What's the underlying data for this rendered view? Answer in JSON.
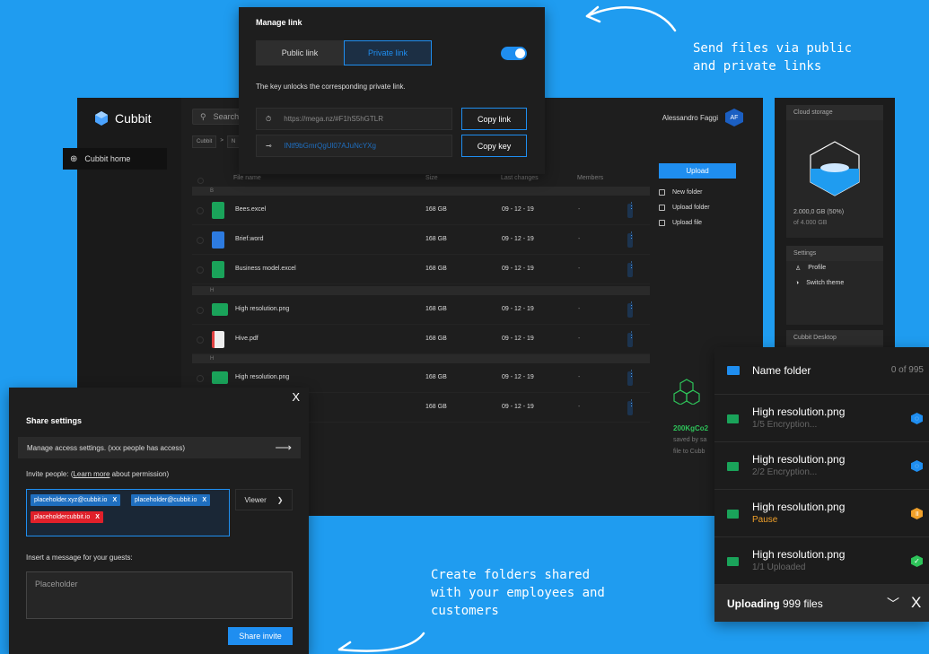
{
  "captions": {
    "top": "Send files via public\nand private links",
    "bottom": "Create folders shared\nwith your employees and\ncustomers"
  },
  "app": {
    "logo": "Cubbit",
    "sidebar_item": "Cubbit home",
    "search_placeholder": "Search",
    "breadcrumbs": [
      "Cubbit",
      "N"
    ],
    "user_name": "Alessandro Faggi",
    "user_initials": "AF",
    "columns": [
      "File name",
      "Size",
      "Last changes",
      "Members"
    ],
    "groups": [
      "B",
      "H",
      "H"
    ],
    "rows": [
      {
        "name": "Bees.excel",
        "size": "168 GB",
        "date": "09 - 12 - 19",
        "members": "-"
      },
      {
        "name": "Brief.word",
        "size": "168 GB",
        "date": "09 - 12 - 19",
        "members": "-"
      },
      {
        "name": "Business model.excel",
        "size": "168 GB",
        "date": "09 - 12 - 19",
        "members": "-"
      },
      {
        "name": "High resolution.png",
        "size": "168 GB",
        "date": "09 - 12 - 19",
        "members": "-"
      },
      {
        "name": "Hive.pdf",
        "size": "168 GB",
        "date": "09 - 12 - 19",
        "members": "-"
      },
      {
        "name": "High resolution.png",
        "size": "168 GB",
        "date": "09 - 12 - 19",
        "members": "-"
      },
      {
        "name": "",
        "size": "168 GB",
        "date": "09 - 12 - 19",
        "members": "-"
      }
    ],
    "upload_label": "Upload",
    "actions": [
      "New folder",
      "Upload folder",
      "Upload file"
    ],
    "co2_value": "200KgCo2",
    "co2_text_1": "saved by sa",
    "co2_text_2": "file to Cubb"
  },
  "right_panel": {
    "cloud_title": "Cloud storage",
    "storage_used": "2.000,0 GB (50%)",
    "storage_total": "of 4.000 GB",
    "storage_fraction": 0.5,
    "settings_title": "Settings",
    "profile": "Profile",
    "switch_theme": "Switch theme",
    "desktop_title": "Cubbit Desktop"
  },
  "manage_link": {
    "title": "Manage link",
    "public_tab": "Public link",
    "private_tab": "Private link",
    "description": "The key unlocks the corresponding private link.",
    "link_value": "https://mega.nz/#F1hS5hGTLR",
    "key_value": "lNtf9bGmrQgUl07AJuNcYXg",
    "copy_link": "Copy link",
    "copy_key": "Copy key"
  },
  "share": {
    "close": "X",
    "title": "Share settings",
    "access_text": "Manage access settings. (xxx people has access)",
    "invite_prefix": "Invite people: (",
    "learn_more": "Learn more",
    "invite_suffix": " about permission)",
    "tags": [
      {
        "text": "placeholder.xyz@cubbit.io",
        "x": "X"
      },
      {
        "text": "placeholder@cubbit.io",
        "x": "X"
      },
      {
        "text": "placeholdercubbit.io",
        "x": "X"
      }
    ],
    "viewer": "Viewer",
    "message_label": "Insert a message for your guests:",
    "message_placeholder": "Placeholder",
    "share_button": "Share invite"
  },
  "uploads": {
    "folder_name": "Name folder",
    "folder_count": "0 of 995",
    "items": [
      {
        "name": "High resolution.png",
        "status": "1/5 Encryption...",
        "color": "#1f8ef0"
      },
      {
        "name": "High resolution.png",
        "status": "2/2 Encryption...",
        "color": "#1f8ef0"
      },
      {
        "name": "High resolution.png",
        "status": "Pause",
        "color": "#f0a02a"
      },
      {
        "name": "High resolution.png",
        "status": "1/1 Uploaded",
        "color": "#2ec45a"
      }
    ],
    "footer_bold": "Uploading",
    "footer_rest": " 999 files",
    "footer_close": "X"
  }
}
